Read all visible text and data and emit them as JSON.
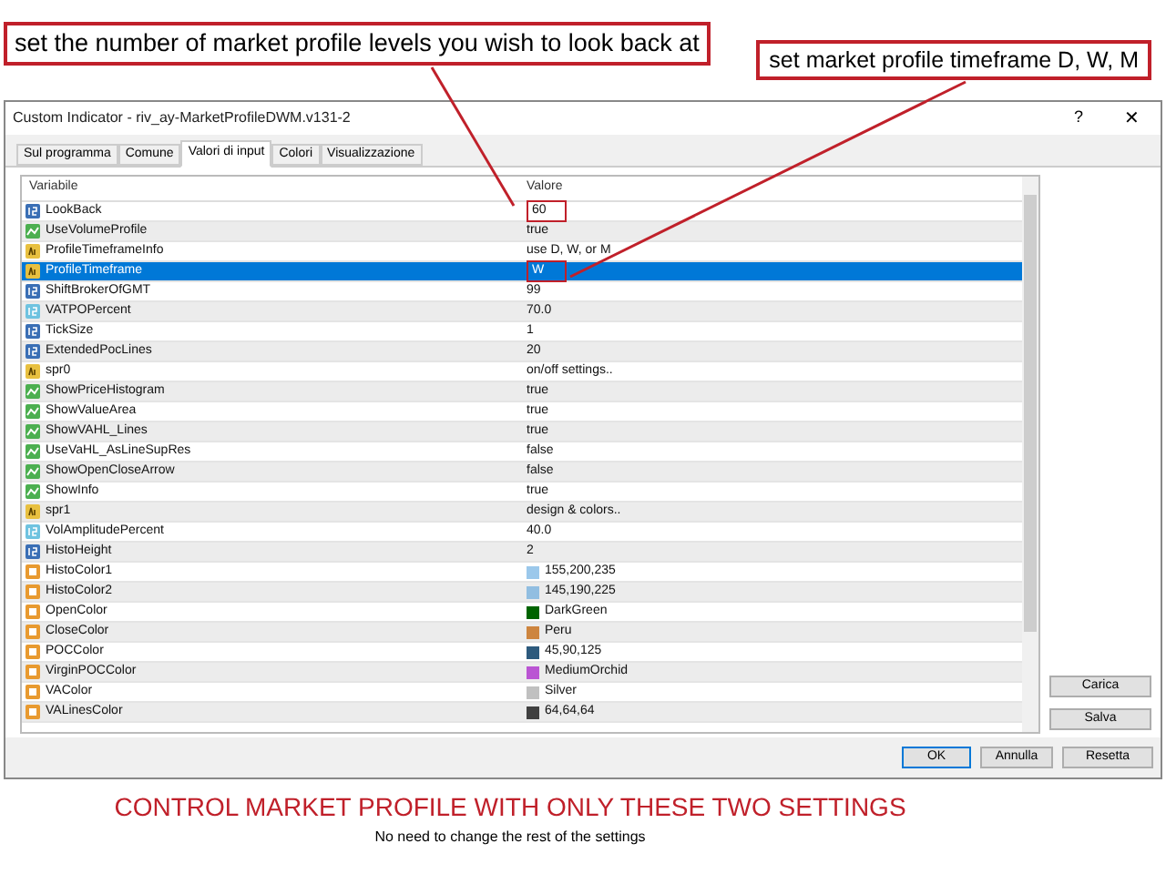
{
  "callouts": [
    {
      "text": "set the number of market profile levels you wish to look back at"
    },
    {
      "text": "set market profile timeframe D, W, M"
    }
  ],
  "window": {
    "title": "Custom Indicator - riv_ay-MarketProfileDWM.v131-2",
    "help": "?",
    "close": "✕"
  },
  "tabs": [
    {
      "label": "Sul programma",
      "selected": false
    },
    {
      "label": "Comune",
      "selected": false
    },
    {
      "label": "Valori di input",
      "selected": true
    },
    {
      "label": "Colori",
      "selected": false
    },
    {
      "label": "Visualizzazione",
      "selected": false
    }
  ],
  "table": {
    "columns": [
      "Variabile",
      "Valore"
    ],
    "rows": [
      {
        "kind": "int",
        "name": "LookBack",
        "value": "60",
        "selected": false,
        "outlined": true
      },
      {
        "kind": "bool",
        "name": "UseVolumeProfile",
        "value": "true",
        "selected": false,
        "outlined": false
      },
      {
        "kind": "string",
        "name": "ProfileTimeframeInfo",
        "value": "use D, W, or M",
        "selected": false,
        "outlined": false
      },
      {
        "kind": "string",
        "name": "ProfileTimeframe",
        "value": "W",
        "selected": true,
        "outlined": true
      },
      {
        "kind": "int",
        "name": "ShiftBrokerOfGMT",
        "value": "99",
        "selected": false,
        "outlined": false
      },
      {
        "kind": "double",
        "name": "VATPOPercent",
        "value": "70.0",
        "selected": false,
        "outlined": false
      },
      {
        "kind": "int",
        "name": "TickSize",
        "value": "1",
        "selected": false,
        "outlined": false
      },
      {
        "kind": "int",
        "name": "ExtendedPocLines",
        "value": "20",
        "selected": false,
        "outlined": false
      },
      {
        "kind": "string",
        "name": "spr0",
        "value": "on/off settings..",
        "selected": false,
        "outlined": false
      },
      {
        "kind": "bool",
        "name": "ShowPriceHistogram",
        "value": "true",
        "selected": false,
        "outlined": false
      },
      {
        "kind": "bool",
        "name": "ShowValueArea",
        "value": "true",
        "selected": false,
        "outlined": false
      },
      {
        "kind": "bool",
        "name": "ShowVAHL_Lines",
        "value": "true",
        "selected": false,
        "outlined": false
      },
      {
        "kind": "bool",
        "name": "UseVaHL_AsLineSupRes",
        "value": "false",
        "selected": false,
        "outlined": false
      },
      {
        "kind": "bool",
        "name": "ShowOpenCloseArrow",
        "value": "false",
        "selected": false,
        "outlined": false
      },
      {
        "kind": "bool",
        "name": "ShowInfo",
        "value": "true",
        "selected": false,
        "outlined": false
      },
      {
        "kind": "string",
        "name": "spr1",
        "value": "design & colors..",
        "selected": false,
        "outlined": false
      },
      {
        "kind": "double",
        "name": "VolAmplitudePercent",
        "value": "40.0",
        "selected": false,
        "outlined": false
      },
      {
        "kind": "int",
        "name": "HistoHeight",
        "value": "2",
        "selected": false,
        "outlined": false
      },
      {
        "kind": "color",
        "name": "HistoColor1",
        "value": "155,200,235",
        "color": "#9bc8eb",
        "selected": false,
        "outlined": false
      },
      {
        "kind": "color",
        "name": "HistoColor2",
        "value": "145,190,225",
        "color": "#91bee1",
        "selected": false,
        "outlined": false
      },
      {
        "kind": "color",
        "name": "OpenColor",
        "value": "DarkGreen",
        "color": "#006400",
        "selected": false,
        "outlined": false
      },
      {
        "kind": "color",
        "name": "CloseColor",
        "value": "Peru",
        "color": "#cd853f",
        "selected": false,
        "outlined": false
      },
      {
        "kind": "color",
        "name": "POCColor",
        "value": "45,90,125",
        "color": "#2d5a7d",
        "selected": false,
        "outlined": false
      },
      {
        "kind": "color",
        "name": "VirginPOCColor",
        "value": "MediumOrchid",
        "color": "#ba55d3",
        "selected": false,
        "outlined": false
      },
      {
        "kind": "color",
        "name": "VAColor",
        "value": "Silver",
        "color": "#c0c0c0",
        "selected": false,
        "outlined": false
      },
      {
        "kind": "color",
        "name": "VALinesColor",
        "value": "64,64,64",
        "color": "#404040",
        "selected": false,
        "outlined": false
      }
    ]
  },
  "side_buttons": [
    "Carica",
    "Salva"
  ],
  "buttons": [
    {
      "label": "OK",
      "default": true
    },
    {
      "label": "Annulla",
      "default": false
    },
    {
      "label": "Resetta",
      "default": false
    }
  ],
  "footer": {
    "title": "CONTROL MARKET PROFILE WITH ONLY THESE TWO SETTINGS",
    "subtitle": "No need to change the rest of the settings"
  }
}
